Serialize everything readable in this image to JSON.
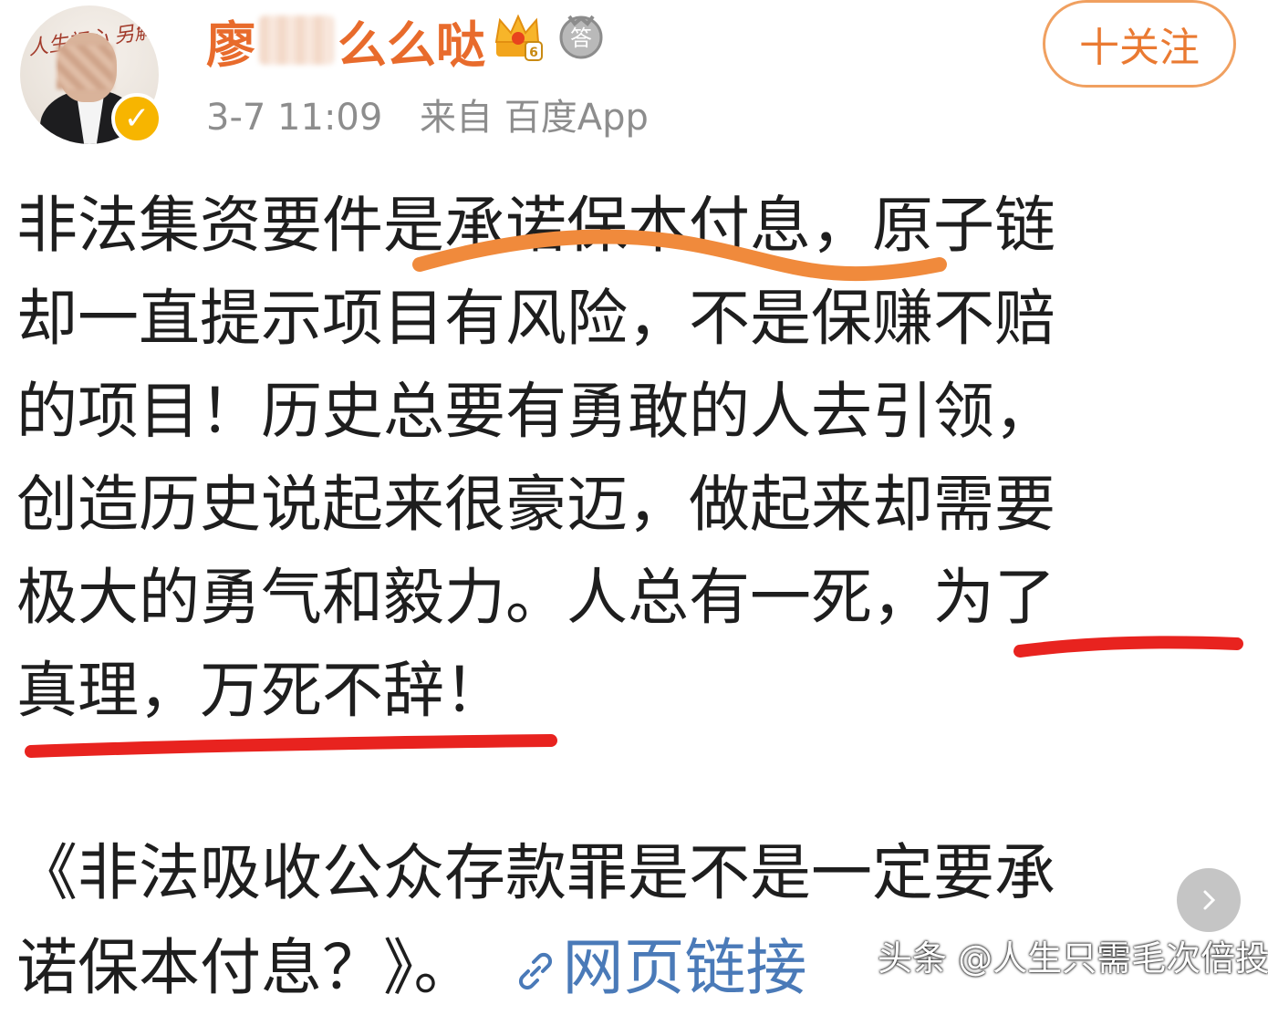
{
  "header": {
    "username_prefix": "廖",
    "username_suffix": "么么哒",
    "timestamp": "3-7 11:09",
    "source": "来自 百度App",
    "follow_label": "十关注",
    "crown_level": "6",
    "medal_label": "答",
    "avatar_calligraphy": "人生初心 另解析"
  },
  "post": {
    "lines": [
      "非法集资要件是承诺保本付息，原子链",
      "却一直提示项目有风险，不是保赚不赔",
      "的项目！历史总要有勇敢的人去引领，",
      "创造历史说起来很豪迈，做起来却需要",
      "极大的勇气和毅力。人总有一死，为了",
      "真理，万死不辞！"
    ]
  },
  "link_post": {
    "line1": "《非法吸收公众存款罪是不是一定要承",
    "line2": "诺保本付息？》。",
    "link_label": "网页链接"
  },
  "watermark": "头条 @人生只需毛次倍投",
  "colors": {
    "username": "#e86b2c",
    "follow": "#ea7a32",
    "orange_underline": "#f08a3c",
    "red_underline": "#e8231f",
    "link": "#4a7ab8"
  },
  "icons": {
    "verify": "verified-v-icon",
    "crown": "crown-icon",
    "medal": "answer-medal-icon",
    "link": "link-icon",
    "next": "chevron-right-icon"
  }
}
